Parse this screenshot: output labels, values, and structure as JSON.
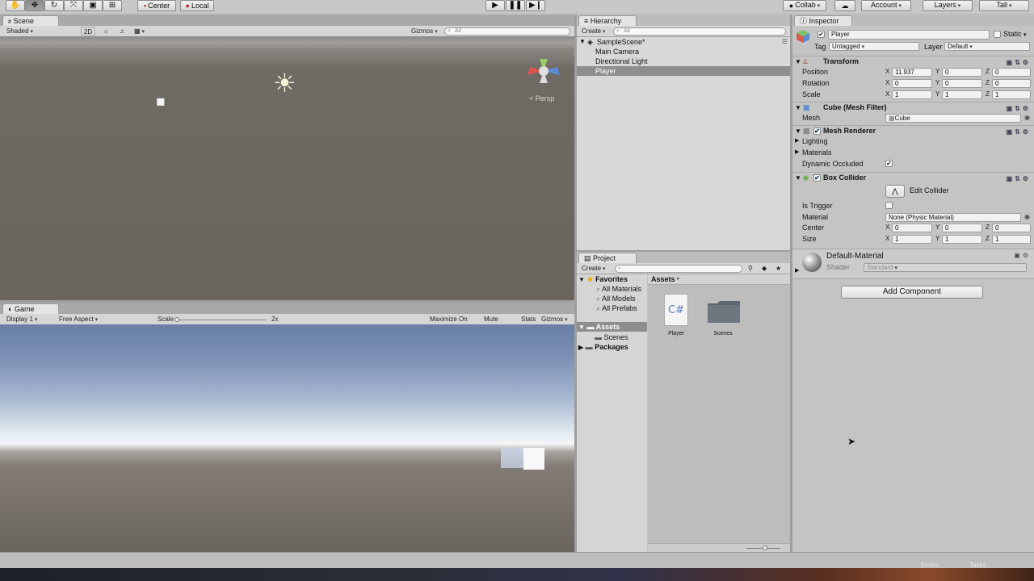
{
  "toolbar": {
    "pivot_label": "Center",
    "space_label": "Local",
    "collab_label": "Collab",
    "account_label": "Account",
    "layers_label": "Layers",
    "layout_label": "Tall"
  },
  "scene": {
    "tab_label": "Scene",
    "shading_mode": "Shaded",
    "mode_2d": "2D",
    "gizmos_label": "Gizmos",
    "search_placeholder": "All",
    "persp_label": "Persp"
  },
  "game": {
    "tab_label": "Game",
    "display": "Display 1",
    "aspect": "Free Aspect",
    "scale_label": "Scale",
    "scale_value": "2x",
    "maximize_label": "Maximize On Play",
    "mute_label": "Mute Audio",
    "stats_label": "Stats",
    "gizmos_label": "Gizmos"
  },
  "hierarchy": {
    "tab_label": "Hierarchy",
    "create_label": "Create",
    "search_placeholder": "All",
    "scene_name": "SampleScene*",
    "items": [
      "Main Camera",
      "Directional Light",
      "Player"
    ]
  },
  "project": {
    "tab_label": "Project",
    "create_label": "Create",
    "favorites_label": "Favorites",
    "favorites": [
      "All Materials",
      "All Models",
      "All Prefabs"
    ],
    "assets_label": "Assets",
    "scenes_label": "Scenes",
    "packages_label": "Packages",
    "breadcrumb": "Assets",
    "asset_items": [
      "Player",
      "Scenes"
    ],
    "csharp_glyph": "C#"
  },
  "inspector": {
    "tab_label": "Inspector",
    "object_name": "Player",
    "static_label": "Static",
    "tag_label": "Tag",
    "tag_value": "Untagged",
    "layer_label": "Layer",
    "layer_value": "Default",
    "transform": {
      "title": "Transform",
      "position_label": "Position",
      "rotation_label": "Rotation",
      "scale_label": "Scale",
      "position": {
        "x": "11.937",
        "y": "0",
        "z": "0"
      },
      "rotation": {
        "x": "0",
        "y": "0",
        "z": "0"
      },
      "scale": {
        "x": "1",
        "y": "1",
        "z": "1"
      }
    },
    "mesh_filter": {
      "title": "Cube (Mesh Filter)",
      "mesh_label": "Mesh",
      "mesh_value": "Cube"
    },
    "mesh_renderer": {
      "title": "Mesh Renderer",
      "lighting_label": "Lighting",
      "materials_label": "Materials",
      "dynamic_occluded_label": "Dynamic Occluded"
    },
    "box_collider": {
      "title": "Box Collider",
      "edit_collider_label": "Edit Collider",
      "is_trigger_label": "Is Trigger",
      "material_label": "Material",
      "material_value": "None (Physic Material)",
      "center_label": "Center",
      "size_label": "Size",
      "center": {
        "x": "0",
        "y": "0",
        "z": "0"
      },
      "size": {
        "x": "1",
        "y": "1",
        "z": "1"
      }
    },
    "material": {
      "name": "Default-Material",
      "shader_label": "Shader",
      "shader_value": "Standard"
    },
    "add_component_label": "Add Component"
  },
  "status": {
    "errors_label": "Errors",
    "tasks_label": "Tasks"
  },
  "axis_labels": {
    "x": "X",
    "y": "Y",
    "z": "Z"
  },
  "colors": {
    "selection": "#8e8e8e",
    "panel_bg": "#c4c4c4",
    "scene_ground": "#6b655f",
    "sky_top": "#6a7fa5"
  }
}
